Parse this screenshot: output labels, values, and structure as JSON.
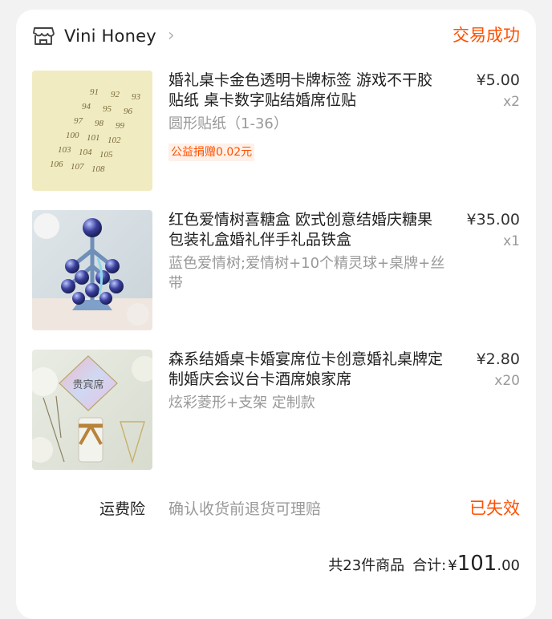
{
  "shop": {
    "name": "Vini Honey",
    "icon": "store-icon",
    "chevron": "›"
  },
  "order": {
    "status": "交易成功"
  },
  "items": [
    {
      "title": "婚礼桌卡金色透明卡牌标签 游戏不干胶贴纸 桌卡数字贴结婚席位贴",
      "sku": "圆形贴纸（1-36）",
      "price": "¥5.00",
      "qty": "x2",
      "charity": "公益捐赠0.02元",
      "image_numbers": [
        "91",
        "92",
        "93",
        "94",
        "95",
        "96",
        "97",
        "98",
        "99",
        "100",
        "101",
        "102",
        "103",
        "104",
        "105",
        "106",
        "107",
        "108"
      ]
    },
    {
      "title": "红色爱情树喜糖盒 欧式创意结婚庆糖果包装礼盒婚礼伴手礼品铁盒",
      "sku": "蓝色爱情树;爱情树+10个精灵球+桌牌+丝带",
      "price": "¥35.00",
      "qty": "x1"
    },
    {
      "title": "森系结婚桌卡婚宴席位卡创意婚礼桌牌定制婚庆会议台卡酒席娘家席",
      "sku": "炫彩菱形+支架 定制款",
      "price": "¥2.80",
      "qty": "x20",
      "image_text": "贵宾席"
    }
  ],
  "insurance": {
    "label": "运费险",
    "desc": "确认收货前退货可理赔",
    "status": "已失效"
  },
  "summary": {
    "count_text": "共23件商品",
    "total_label": "合计:",
    "currency": "¥",
    "total_int": "101",
    "total_dec": ".00"
  },
  "colors": {
    "accent": "#ff5000",
    "muted": "#999999",
    "text": "#1f1f1f",
    "card": "#ffffff"
  }
}
